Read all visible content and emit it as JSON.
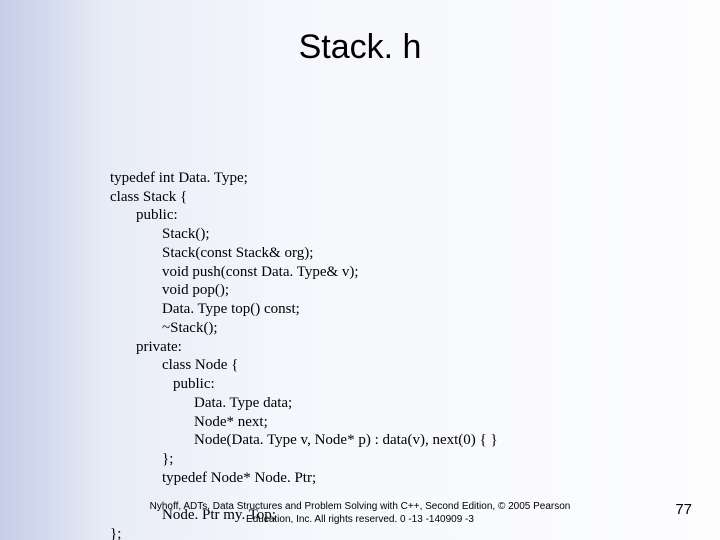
{
  "title": "Stack. h",
  "code": {
    "l1": "typedef int Data. Type;",
    "l2": "class Stack {",
    "l3": "public:",
    "l4": "Stack();",
    "l5": "Stack(const Stack& org);",
    "l6": "void push(const Data. Type& v);",
    "l7": "void pop();",
    "l8": "Data. Type top() const;",
    "l9": "~Stack();",
    "l10": "private:",
    "l11": "class Node {",
    "l12": "public:",
    "l13": "Data. Type data;",
    "l14": "Node* next;",
    "l15": "Node(Data. Type v, Node* p) : data(v), next(0) { }",
    "l16": "};",
    "l17": "typedef Node* Node. Ptr;",
    "l18": "",
    "l19": "Node. Ptr my. Top;",
    "l20": "};"
  },
  "footer": {
    "line1": "Nyhoff, ADTs, Data Structures and Problem Solving with C++, Second Edition, © 2005 Pearson",
    "line2": "Education, Inc. All rights reserved. 0 -13 -140909 -3"
  },
  "page": "77"
}
